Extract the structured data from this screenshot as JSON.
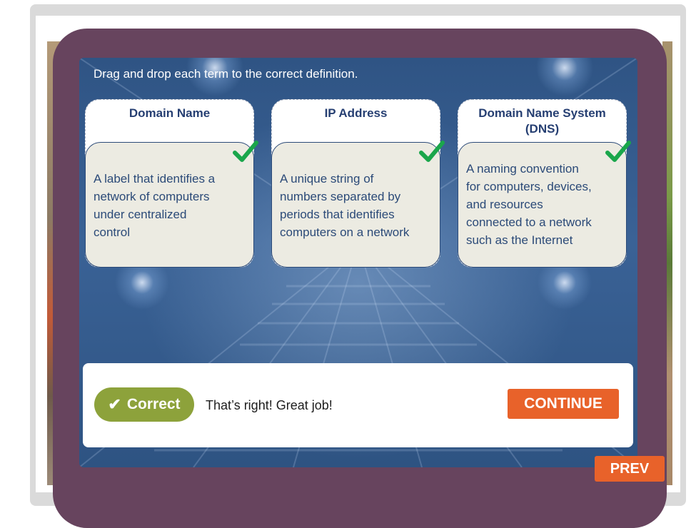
{
  "instructions": "Drag and drop each term to the correct definition.",
  "terms": [
    {
      "title": "Domain Name",
      "definition_lines": [
        "A label that identifies a",
        "network of computers",
        "under centralized",
        "control"
      ],
      "status_icon": "checkmark-icon"
    },
    {
      "title": "IP Address",
      "definition_lines": [
        "A unique string of",
        "numbers separated by",
        "periods that identifies",
        "computers on a network"
      ],
      "status_icon": "checkmark-icon"
    },
    {
      "title_lines": [
        "Domain Name System",
        "(DNS)"
      ],
      "definition_lines": [
        "A naming convention",
        "for computers, devices,",
        "and resources",
        "connected to a network",
        "such as the Internet"
      ],
      "status_icon": "checkmark-icon"
    }
  ],
  "feedback": {
    "status_label": "Correct",
    "status_icon": "checkmark-icon",
    "message": "That’s right! Great job!",
    "continue_label": "CONTINUE"
  },
  "nav": {
    "prev_label": "PREV"
  },
  "colors": {
    "panel": "#67445e",
    "stage": "#2f5484",
    "term_title": "#263f72",
    "definition_bg": "#ecebe2",
    "correct_green": "#8da23b",
    "check_green": "#1aa64b",
    "accent_orange": "#e8622a"
  }
}
